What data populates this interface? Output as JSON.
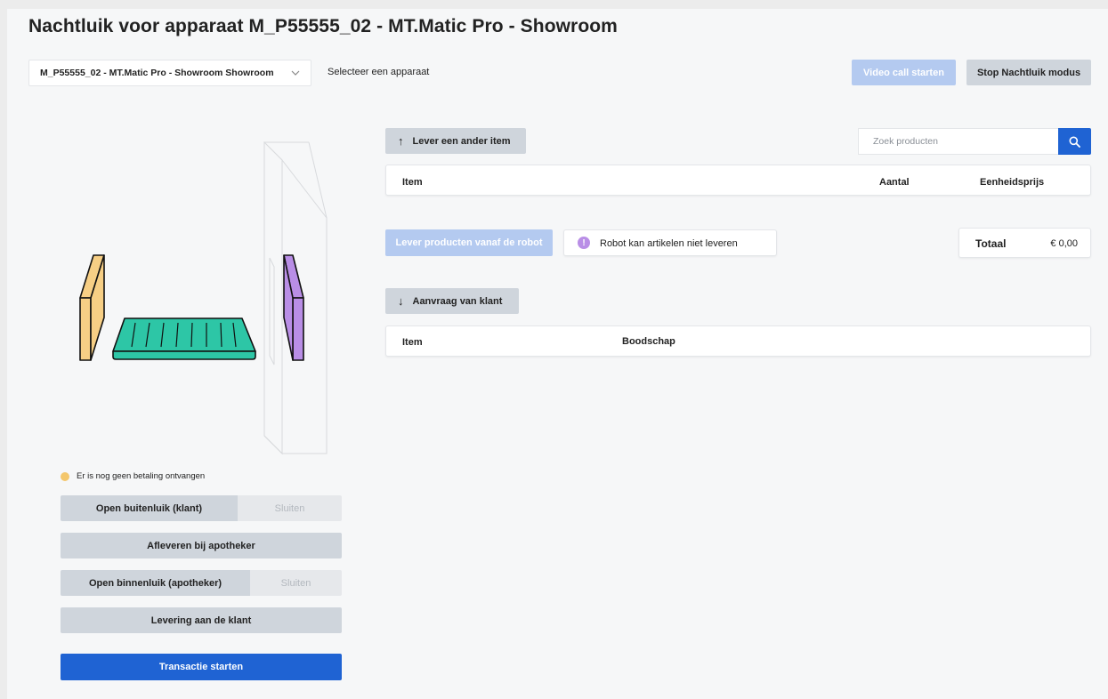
{
  "header": {
    "title": "Nachtluik voor apparaat M_P55555_02 - MT.Matic Pro - Showroom",
    "device_select_value": "M_P55555_02 - MT.Matic Pro - Showroom Showroom",
    "device_select_hint": "Selecteer een apparaat",
    "video_call_label": "Video call starten",
    "stop_mode_label": "Stop Nachtluik modus"
  },
  "controls": {
    "payment_status": "Er is nog geen betaling ontvangen",
    "open_outer_label": "Open buitenluik (klant)",
    "close_outer_label": "Sluiten",
    "deliver_pharmacist_label": "Afleveren bij apotheker",
    "open_inner_label": "Open binnenluik (apotheker)",
    "close_inner_label": "Sluiten",
    "deliver_customer_label": "Levering aan de klant",
    "start_transaction_label": "Transactie starten"
  },
  "deliver": {
    "other_item_label": "Lever een ander item",
    "search_placeholder": "Zoek producten",
    "columns": {
      "item": "Item",
      "quantity": "Aantal",
      "unit_price": "Eenheidsprijs"
    },
    "robot_deliver_label": "Lever producten vanaf de robot",
    "robot_warning": "Robot kan artikelen niet leveren",
    "total_label": "Totaal",
    "total_value": "€ 0,00"
  },
  "request": {
    "label": "Aanvraag van klant",
    "columns": {
      "item": "Item",
      "message": "Boodschap"
    }
  },
  "icons": {
    "arrow_up": "↑",
    "arrow_down": "↓",
    "chevron": "⌄",
    "info": "!"
  },
  "colors": {
    "primary": "#1f63d3",
    "primary_disabled": "#b4caf0",
    "button_gray": "#cfd5dc",
    "outer_hatch": "#f7cf85",
    "tray": "#2dc6a6",
    "inner_hatch": "#b98ee6",
    "status_pending": "#f4c76c"
  }
}
